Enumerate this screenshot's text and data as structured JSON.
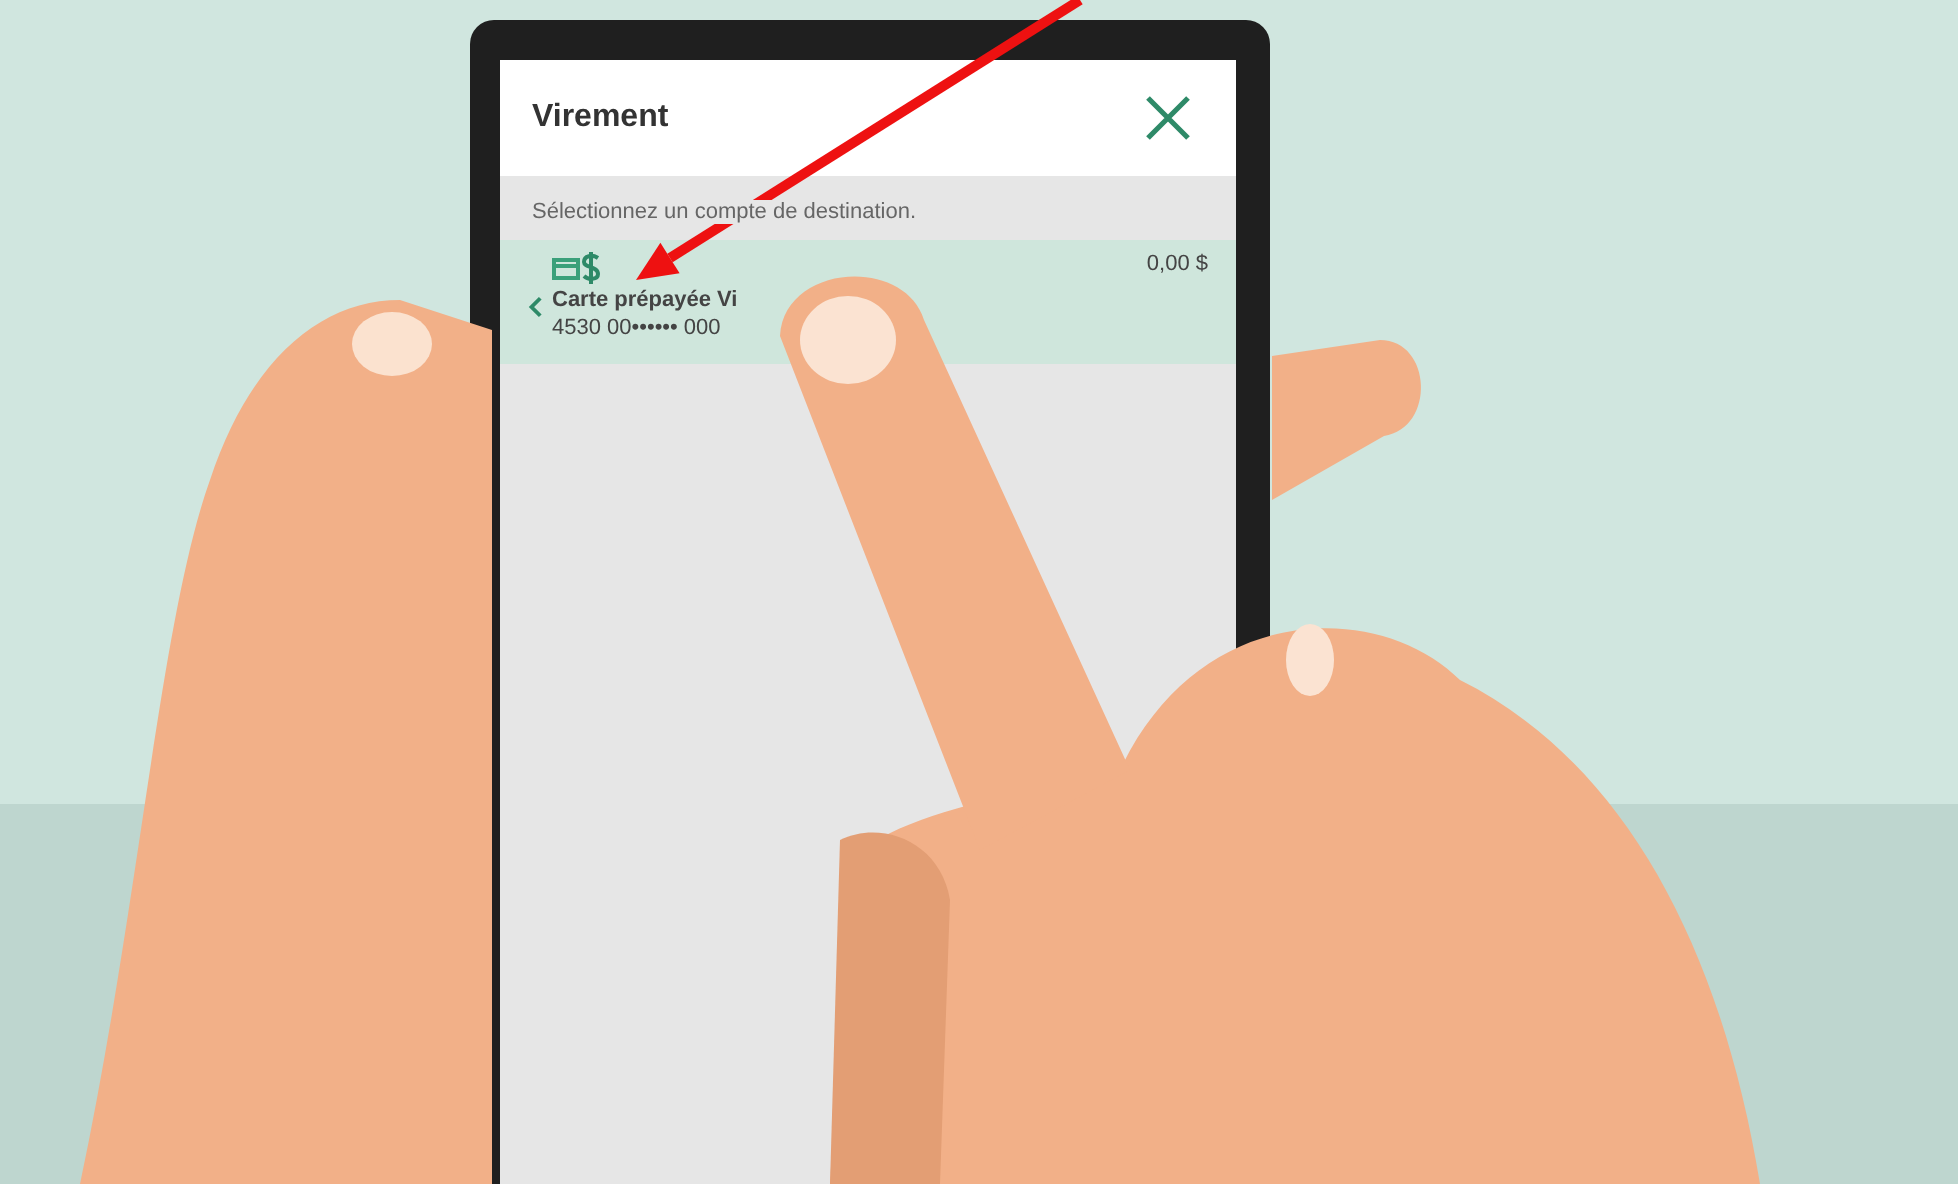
{
  "app": {
    "title": "Virement",
    "prompt": "Sélectionnez un compte de destination.",
    "accounts": [
      {
        "name": "Carte prépayée Vi",
        "number": "4530 00•••••• 000",
        "balance": "0,00 $",
        "selected": true
      }
    ]
  }
}
